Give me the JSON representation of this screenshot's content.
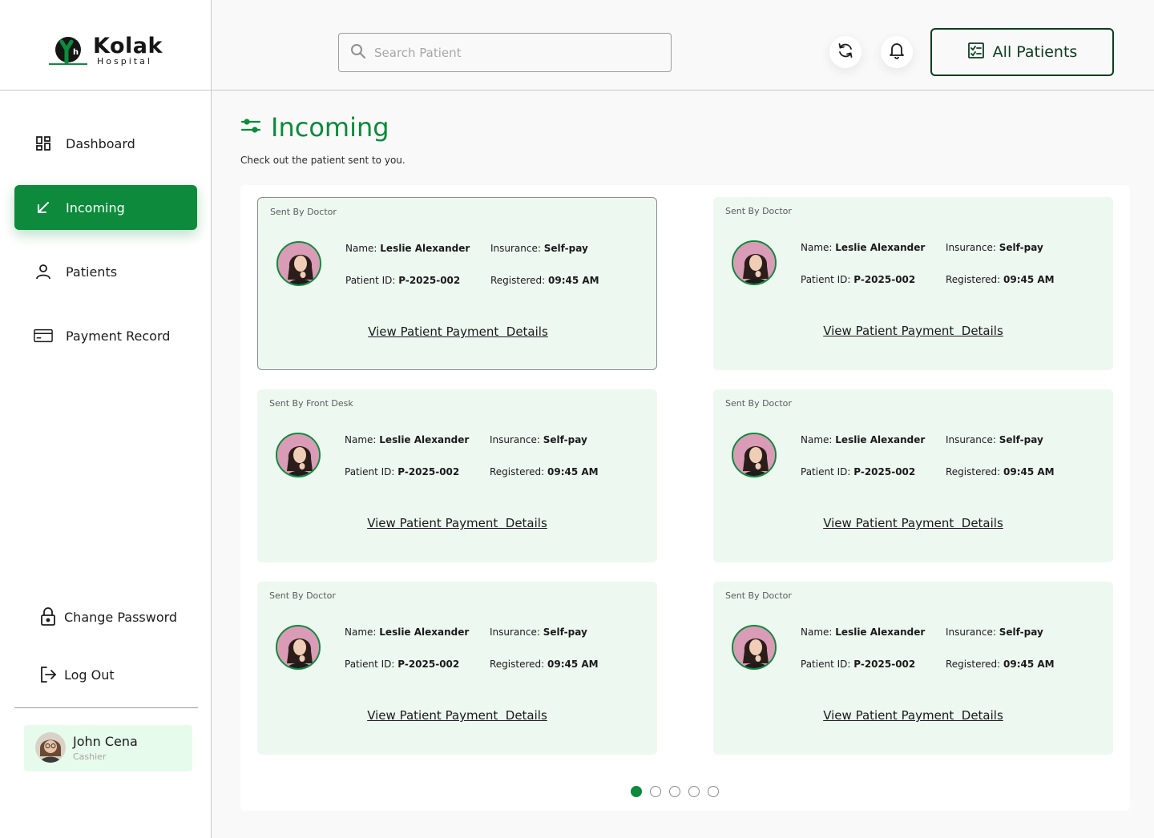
{
  "brand": {
    "name": "Kolak",
    "subtitle": "Hospital",
    "mark_letters": "Yh"
  },
  "sidebar": {
    "items": [
      {
        "label": "Dashboard",
        "icon": "dashboard-icon"
      },
      {
        "label": "Incoming",
        "icon": "incoming-arrow-icon",
        "active": true
      },
      {
        "label": "Patients",
        "icon": "user-icon"
      },
      {
        "label": "Payment Record",
        "icon": "credit-card-icon"
      }
    ],
    "change_password": "Change Password",
    "logout": "Log Out",
    "user": {
      "name": "John Cena",
      "role": "Cashier"
    }
  },
  "header": {
    "search_placeholder": "Search Patient",
    "all_patients": "All Patients"
  },
  "page": {
    "title": "Incoming",
    "subtitle": "Check out the patient sent to you."
  },
  "cards": [
    {
      "sent_by": "Sent By Doctor",
      "name_label": "Name:",
      "name": "Leslie Alexander",
      "insurance_label": "Insurance:",
      "insurance": "Self-pay",
      "pid_label": "Patient ID:",
      "pid": "P-2025-002",
      "reg_label": "Registered:",
      "registered": "09:45 AM",
      "link": "View Patient Payment  Details",
      "selected": true
    },
    {
      "sent_by": "Sent By Doctor",
      "name_label": "Name:",
      "name": "Leslie Alexander",
      "insurance_label": "Insurance:",
      "insurance": "Self-pay",
      "pid_label": "Patient ID:",
      "pid": "P-2025-002",
      "reg_label": "Registered:",
      "registered": "09:45 AM",
      "link": "View Patient Payment  Details"
    },
    {
      "sent_by": "Sent By Front Desk",
      "name_label": "Name:",
      "name": "Leslie Alexander",
      "insurance_label": "Insurance:",
      "insurance": "Self-pay",
      "pid_label": "Patient ID:",
      "pid": "P-2025-002",
      "reg_label": "Registered:",
      "registered": "09:45 AM",
      "link": "View Patient Payment  Details"
    },
    {
      "sent_by": "Sent By Doctor",
      "name_label": "Name:",
      "name": "Leslie Alexander",
      "insurance_label": "Insurance:",
      "insurance": "Self-pay",
      "pid_label": "Patient ID:",
      "pid": "P-2025-002",
      "reg_label": "Registered:",
      "registered": "09:45 AM",
      "link": "View Patient Payment  Details"
    },
    {
      "sent_by": "Sent By Doctor",
      "name_label": "Name:",
      "name": "Leslie Alexander",
      "insurance_label": "Insurance:",
      "insurance": "Self-pay",
      "pid_label": "Patient ID:",
      "pid": "P-2025-002",
      "reg_label": "Registered:",
      "registered": "09:45 AM",
      "link": "View Patient Payment  Details"
    },
    {
      "sent_by": "Sent By Doctor",
      "name_label": "Name:",
      "name": "Leslie Alexander",
      "insurance_label": "Insurance:",
      "insurance": "Self-pay",
      "pid_label": "Patient ID:",
      "pid": "P-2025-002",
      "reg_label": "Registered:",
      "registered": "09:45 AM",
      "link": "View Patient Payment  Details"
    }
  ],
  "pagination": {
    "pages": 5,
    "current": 1
  },
  "colors": {
    "primary": "#0d8a3b",
    "card_bg": "#edf8f0",
    "user_card_bg": "#e6fbec",
    "dark_green": "#0e3d1f"
  }
}
